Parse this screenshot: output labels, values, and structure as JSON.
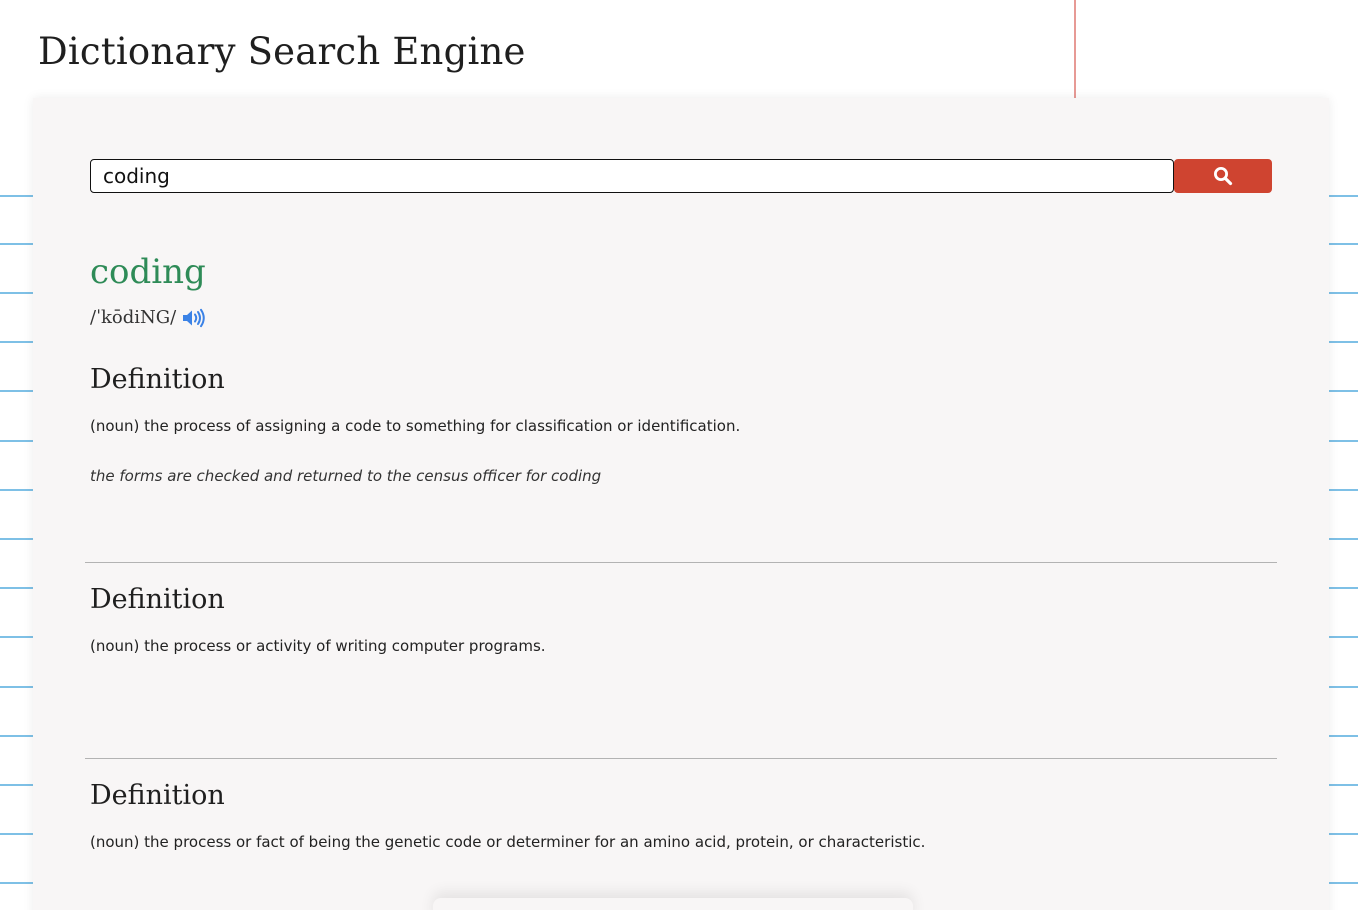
{
  "header": {
    "title": "Dictionary Search Engine"
  },
  "search": {
    "value": "coding",
    "button_icon": "search-icon"
  },
  "result": {
    "word": "coding",
    "phonetic": "/ˈkōdiNG/",
    "audio_icon": "speaker-icon",
    "definitions": [
      {
        "heading": "Definition",
        "text": "(noun) the process of assigning a code to something for classification or identification.",
        "example": "the forms are checked and returned to the census officer for coding"
      },
      {
        "heading": "Definition",
        "text": "(noun) the process or activity of writing computer programs."
      },
      {
        "heading": "Definition",
        "text": "(noun) the process or fact of being the genetic code or determiner for an amino acid, protein, or characteristic."
      }
    ]
  },
  "colors": {
    "word": "#2e8b57",
    "search_button": "#cf4430",
    "audio_icon": "#3b82e6",
    "paper_lines": "#7ec0e6",
    "margin_line": "#e79a95"
  }
}
